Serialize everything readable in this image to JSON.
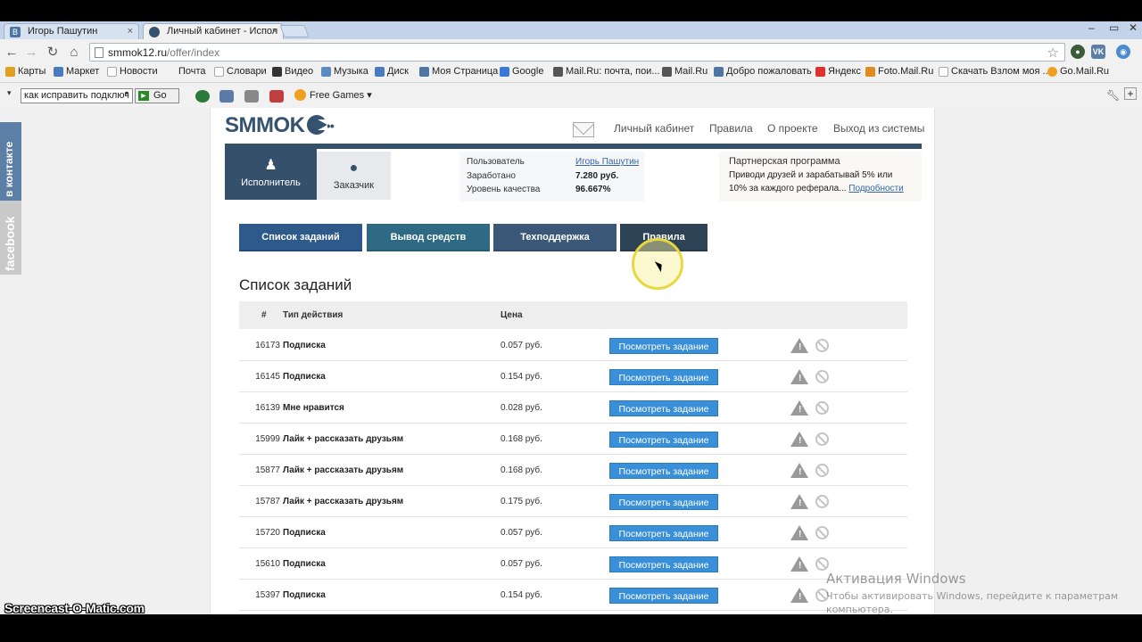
{
  "browser": {
    "tabs": [
      {
        "title": "Игорь Пашутин",
        "active": false
      },
      {
        "title": "Личный кабинет - Испол",
        "active": true
      }
    ],
    "url_host": "smmok12.ru",
    "url_path": "/offer/index",
    "bookmarks": [
      "Карты",
      "Маркет",
      "Новости",
      "Почта",
      "Словари",
      "Видео",
      "Музыка",
      "Диск",
      "Моя Страница",
      "Google",
      "Mail.Ru: почта, пои...",
      "Mail.Ru",
      "Добро пожаловать",
      "Яндекс",
      "Foto.Mail.Ru",
      "Скачать Взлом моя ...",
      "Go.Mail.Ru"
    ],
    "toolbar": {
      "search_value": "как исправить подключ",
      "go_label": "Go",
      "free_games": "Free Games"
    }
  },
  "side_widgets": {
    "vk": "в контакте",
    "fb": "facebook"
  },
  "site": {
    "logo": "SMMOK",
    "logo_dots": "••",
    "nav": [
      "Личный кабинет",
      "Правила",
      "О проекте",
      "Выход из системы"
    ],
    "roles": {
      "executor": "Исполнитель",
      "customer": "Заказчик"
    },
    "user": {
      "user_label": "Пользователь",
      "user_value": "Игорь Пашутин",
      "earned_label": "Заработано",
      "earned_value": "7.280 руб.",
      "quality_label": "Уровень качества",
      "quality_value": "96.667%"
    },
    "partner": {
      "title": "Партнерская программа",
      "line1": "Приводи друзей и зарабатывай 5% или",
      "line2": "10% за каждого реферала...",
      "link": "Подробности"
    },
    "buttons": [
      {
        "label": "Список заданий",
        "color": "#2d5a8a"
      },
      {
        "label": "Вывод средств",
        "color": "#2f6a85"
      },
      {
        "label": "Техподдержка",
        "color": "#3b5878"
      },
      {
        "label": "Правила",
        "color": "#2e4356"
      }
    ],
    "section_title": "Список заданий",
    "table_headers": {
      "num": "#",
      "type": "Тип действия",
      "price": "Цена"
    },
    "view_button_label": "Посмотреть задание",
    "tasks": [
      {
        "id": "16173",
        "type": "Подписка",
        "price": "0.057 руб."
      },
      {
        "id": "16145",
        "type": "Подписка",
        "price": "0.154 руб."
      },
      {
        "id": "16139",
        "type": "Мне нравится",
        "price": "0.028 руб."
      },
      {
        "id": "15999",
        "type": "Лайк + рассказать друзьям",
        "price": "0.168 руб."
      },
      {
        "id": "15877",
        "type": "Лайк + рассказать друзьям",
        "price": "0.168 руб."
      },
      {
        "id": "15787",
        "type": "Лайк + рассказать друзьям",
        "price": "0.175 руб."
      },
      {
        "id": "15720",
        "type": "Подписка",
        "price": "0.057 руб."
      },
      {
        "id": "15610",
        "type": "Подписка",
        "price": "0.057 руб."
      },
      {
        "id": "15397",
        "type": "Подписка",
        "price": "0.154 руб."
      }
    ]
  },
  "overlay": {
    "activation_title": "Активация Windows",
    "activation_text": "Чтобы активировать Windows, перейдите к параметрам компьютера.",
    "watermark": "Screencast-O-Matic.com"
  }
}
